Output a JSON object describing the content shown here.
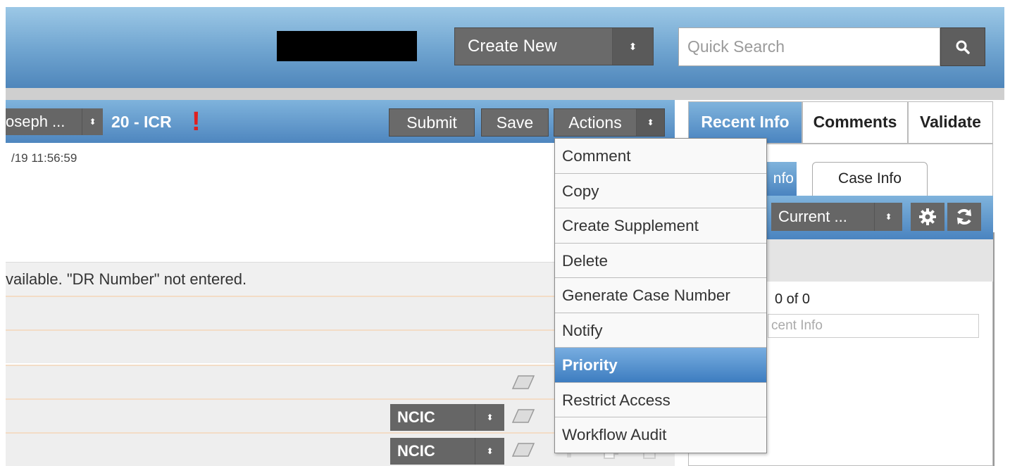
{
  "header": {
    "create_new": {
      "label": "Create New",
      "arrow": "⬍"
    },
    "quick_search": {
      "placeholder": "Quick Search"
    },
    "search_icon": "search-icon"
  },
  "case_header": {
    "person_select": "oseph ...",
    "case_label": "20 - ICR",
    "alert_mark": "!",
    "submit_label": "Submit",
    "save_label": "Save",
    "actions_label": "Actions"
  },
  "main": {
    "timestamp": "/19 11:56:59",
    "message": "vailable. \"DR Number\" not entered.",
    "ncic_rows": [
      "NCIC",
      "NCIC"
    ]
  },
  "actions_menu": {
    "items": [
      {
        "label": "Comment",
        "active": false
      },
      {
        "label": "Copy",
        "active": false
      },
      {
        "label": "Create Supplement",
        "active": false
      },
      {
        "label": "Delete",
        "active": false
      },
      {
        "label": "Generate Case Number",
        "active": false
      },
      {
        "label": "Notify",
        "active": false
      },
      {
        "label": "Priority",
        "active": true
      },
      {
        "label": "Restrict Access",
        "active": false
      },
      {
        "label": "Workflow Audit",
        "active": false
      }
    ]
  },
  "right_panel": {
    "tabs": [
      {
        "label": "Recent Info",
        "active": true
      },
      {
        "label": "Comments",
        "active": false
      },
      {
        "label": "Validate",
        "active": false
      }
    ],
    "subtabs": {
      "info_label": "nfo",
      "case_info_label": "Case Info"
    },
    "current_select": "Current ...",
    "count_text": "0 of 0",
    "filter_placeholder": "cent Info"
  },
  "colors": {
    "header_blue": "#4f86bb",
    "button_gray": "#6a6a6a",
    "active_blue": "#3d7dc0",
    "alert_red": "#e02020"
  }
}
